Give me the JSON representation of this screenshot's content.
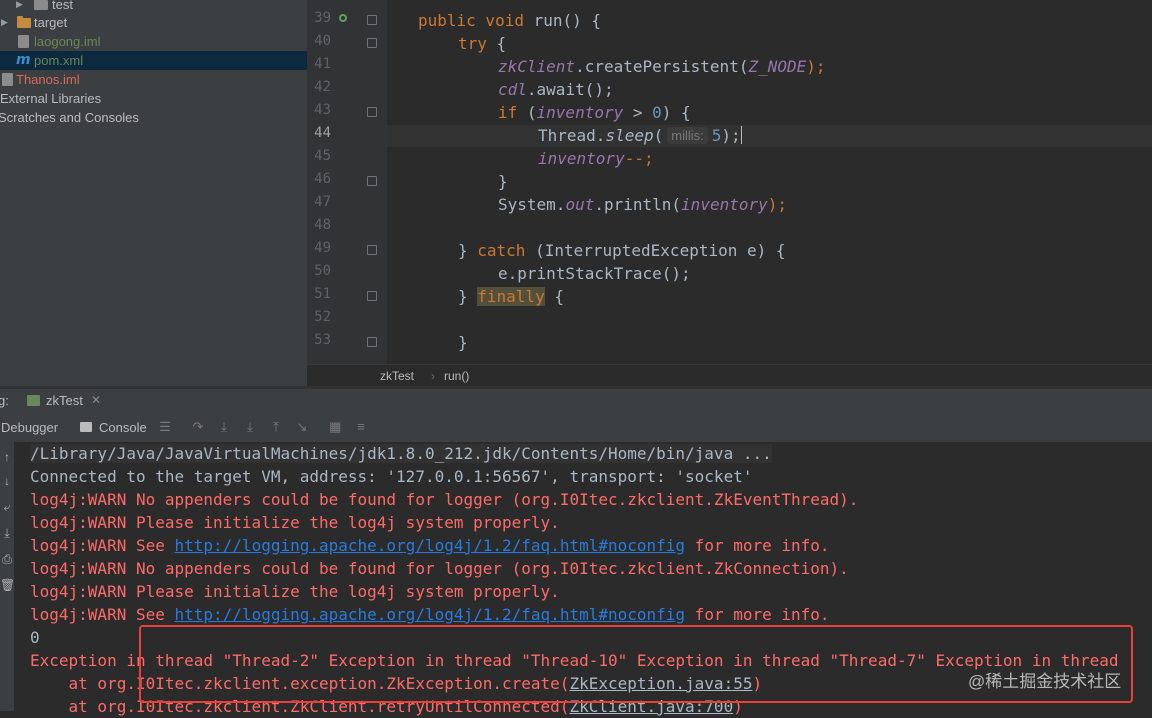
{
  "project_tree": {
    "items": [
      {
        "label": "test",
        "kind": "folder",
        "color": "#8a8a8a"
      },
      {
        "label": "target",
        "kind": "folder",
        "color": "#c58c3f"
      },
      {
        "label": "laogong.iml",
        "kind": "file"
      },
      {
        "label": "pom.xml",
        "kind": "maven"
      },
      {
        "label": "Thanos.iml",
        "kind": "file"
      },
      {
        "label": "External Libraries",
        "kind": "node"
      },
      {
        "label": "Scratches and Consoles",
        "kind": "node"
      }
    ]
  },
  "editor": {
    "line_numbers": [
      "39",
      "40",
      "41",
      "42",
      "43",
      "44",
      "45",
      "46",
      "47",
      "48",
      "49",
      "50",
      "51",
      "52",
      "53"
    ],
    "current_line": "44",
    "code": {
      "l39_kw": "public void ",
      "l39_rest": "run() {",
      "l40_kw": "try",
      "l40_rest": " {",
      "l41_fld": "zkClient",
      "l41_mid": ".createPersistent(",
      "l41_sfld": "Z_NODE",
      "l41_end": ");",
      "l42_fld": "cdl",
      "l42_end": ".await();",
      "l43_kw": "if",
      "l43_open": " (",
      "l43_fld": "inventory",
      "l43_op": " > ",
      "l43_num": "0",
      "l43_end": ") {",
      "l44_cls": "Thread.",
      "l44_mth": "sleep",
      "l44_paren": "(",
      "l44_hint": "millis:",
      "l44_num": "5",
      "l44_end": ");",
      "l45_fld": "inventory",
      "l45_end": "--;",
      "l46": "}",
      "l47_pre": "System.",
      "l47_out": "out",
      "l47_mid": ".println(",
      "l47_fld": "inventory",
      "l47_end": ");",
      "l49_close": "} ",
      "l49_kw": "catch",
      "l49_rest": " (InterruptedException e) {",
      "l50": "e.printStackTrace();",
      "l51_close": "} ",
      "l51_kw": "finally",
      "l51_rest": " {",
      "l53": "}"
    },
    "breadcrumb": [
      "zkTest",
      "run()"
    ]
  },
  "debug": {
    "label": "g:",
    "session_tab": "zkTest",
    "tabs": [
      "Debugger",
      "Console"
    ],
    "console_lines": [
      {
        "text": "/Library/Java/JavaVirtualMachines/jdk1.8.0_212.jdk/Contents/Home/bin/java ...",
        "style": "gray"
      },
      {
        "text": "Connected to the target VM, address: '127.0.0.1:56567', transport: 'socket'",
        "style": "gray"
      },
      {
        "text": "log4j:WARN No appenders could be found for logger (org.I0Itec.zkclient.ZkEventThread).",
        "style": "red"
      },
      {
        "text": "log4j:WARN Please initialize the log4j system properly.",
        "style": "red"
      },
      {
        "pre": "log4j:WARN See ",
        "link": "http://logging.apache.org/log4j/1.2/faq.html#noconfig",
        "post": " for more info.",
        "style": "red"
      },
      {
        "text": "log4j:WARN No appenders could be found for logger (org.I0Itec.zkclient.ZkConnection).",
        "style": "red"
      },
      {
        "text": "log4j:WARN Please initialize the log4j system properly.",
        "style": "red"
      },
      {
        "pre": "log4j:WARN See ",
        "link": "http://logging.apache.org/log4j/1.2/faq.html#noconfig",
        "post": " for more info.",
        "style": "red"
      },
      {
        "text": "0",
        "style": "gray"
      },
      {
        "text": "Exception in thread \"Thread-2\" Exception in thread \"Thread-10\" Exception in thread \"Thread-7\" Exception in thread",
        "style": "red"
      },
      {
        "pre": "    at org.I0Itec.zkclient.exception.ZkException.create(",
        "link": "ZkException.java:55",
        "post": ")",
        "style": "red"
      },
      {
        "pre": "    at org.I0Itec.zkclient.ZkClient.retryUntilConnected(",
        "link": "ZkClient.java:700",
        "post": ")",
        "style": "red"
      }
    ]
  },
  "watermark": "@稀土掘金技术社区",
  "colors": {
    "keyword": "#cc7832",
    "field": "#9876aa",
    "number": "#6897bb",
    "error": "#ff6b68",
    "link": "#287bde",
    "highlight_box": "#e8403a"
  }
}
